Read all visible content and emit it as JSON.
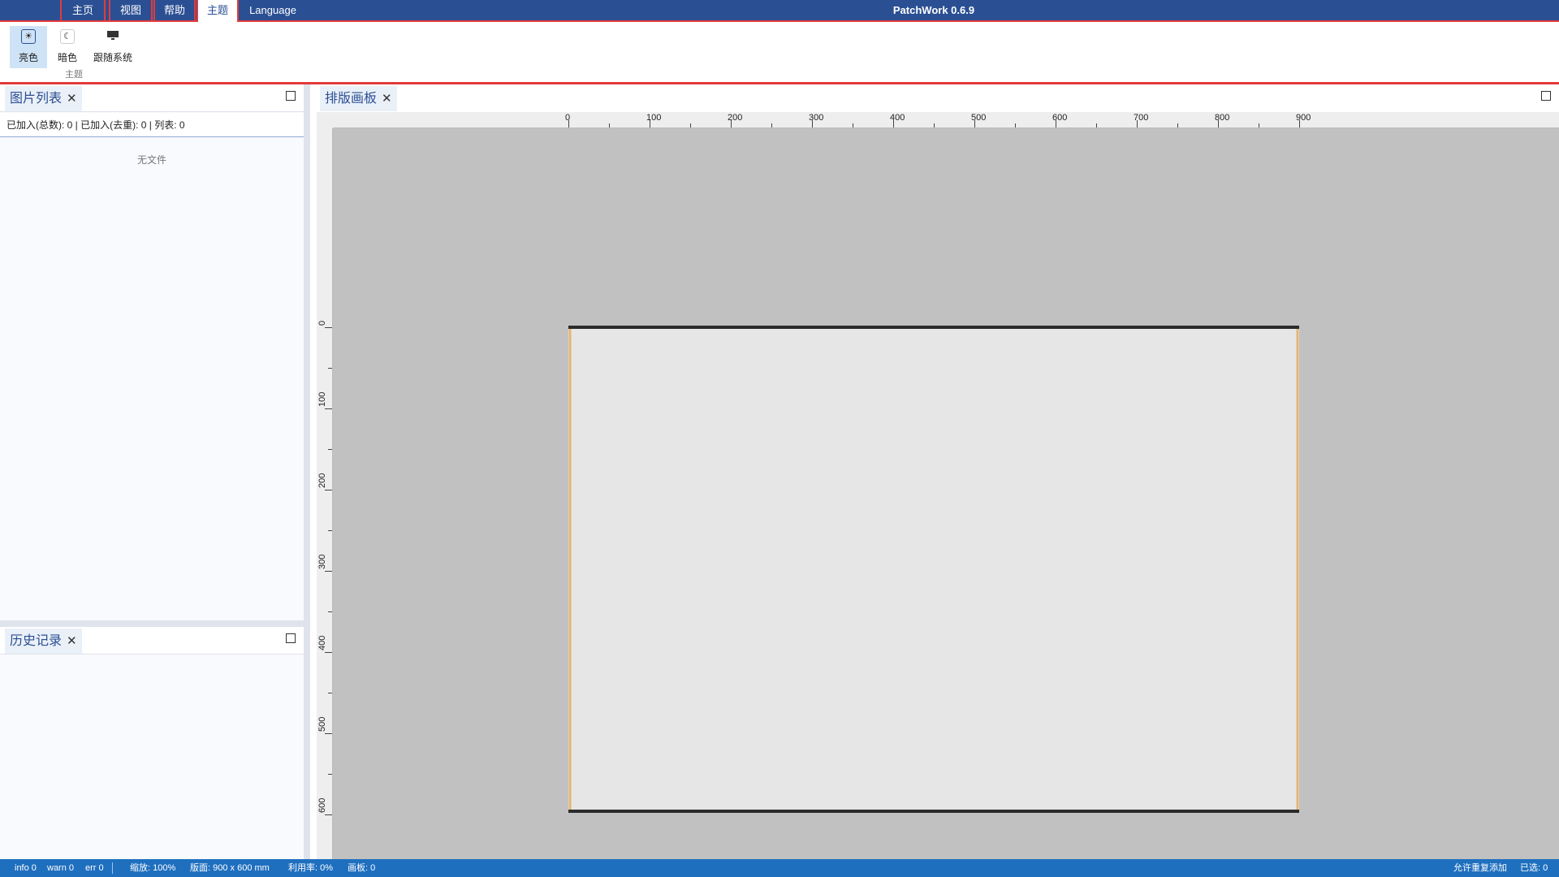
{
  "menubar": {
    "items": [
      "主页",
      "视图",
      "帮助",
      "主题",
      "Language"
    ],
    "active_index": 3,
    "app_title": "PatchWork 0.6.9"
  },
  "ribbon": {
    "buttons": [
      {
        "label": "亮色",
        "icon": "sun-icon",
        "selected": true
      },
      {
        "label": "暗色",
        "icon": "moon-icon",
        "selected": false
      },
      {
        "label": "跟随系统",
        "icon": "monitor-icon",
        "selected": false
      }
    ],
    "group_label": "主题"
  },
  "image_list": {
    "title": "图片列表",
    "close": "✕",
    "stats": "已加入(总数): 0 | 已加入(去重): 0 | 列表: 0",
    "empty_text": "无文件"
  },
  "history": {
    "title": "历史记录",
    "close": "✕"
  },
  "canvas": {
    "title": "排版画板",
    "close": "✕",
    "ruler_top_labels": [
      "0",
      "100",
      "200",
      "300",
      "400",
      "500",
      "600",
      "700",
      "800",
      "900"
    ],
    "ruler_left_labels": [
      "0",
      "100",
      "200",
      "300",
      "400",
      "500",
      "600"
    ],
    "board_fill": "#e6e6e6",
    "board_border": "#2b2b2b",
    "board_side_accent": "#e6b574",
    "background": "#c1c1c1"
  },
  "statusbar": {
    "info": "info 0",
    "warn": "warn 0",
    "err": "err 0",
    "zoom": "缩放: 100%",
    "layout_size": "版面: 900 x 600 mm",
    "utilization": "利用率: 0%",
    "boards": "画板: 0",
    "allow_duplicates": "允许重复添加",
    "selected": "已选: 0"
  },
  "colors": {
    "menubar_bg": "#2b4f93",
    "highlight_red": "#e23b3b",
    "status_bg": "#1f6fbf"
  }
}
